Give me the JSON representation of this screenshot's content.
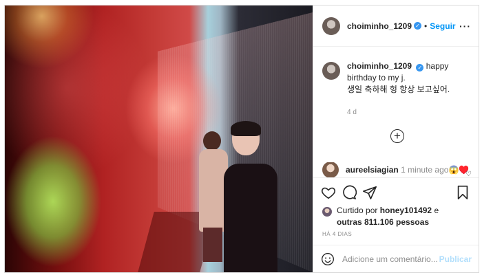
{
  "post": {
    "username": "choiminho_1209",
    "verified": true,
    "follow_label": "Seguir",
    "caption_line1": "happy birthday to my j.",
    "caption_line2": "생일 축하해 형 항상 보고싶어.",
    "caption_age": "4 d"
  },
  "comment": {
    "username": "aureelsiagian",
    "age": "1 minute ago",
    "emojis": "😱♥️"
  },
  "likes": {
    "prefix": "Curtido por",
    "user": "honey101492",
    "joiner": "e",
    "others": "outras 811.106 pessoas"
  },
  "date_label": "HÁ 4 DIAS",
  "add_comment": {
    "placeholder": "Adicione um comentário...",
    "post_label": "Publicar"
  },
  "icons": {
    "verified": "verified-badge-icon",
    "more": "more-options-icon",
    "load_more": "plus-circle-icon",
    "like": "heart-icon",
    "comment": "comment-icon",
    "share": "send-icon",
    "save": "bookmark-icon",
    "emoji": "smiley-icon"
  },
  "colors": {
    "accent": "#0095f6",
    "verified": "#3897f0",
    "muted": "#8e8e8e",
    "border": "#dbdbdb"
  }
}
